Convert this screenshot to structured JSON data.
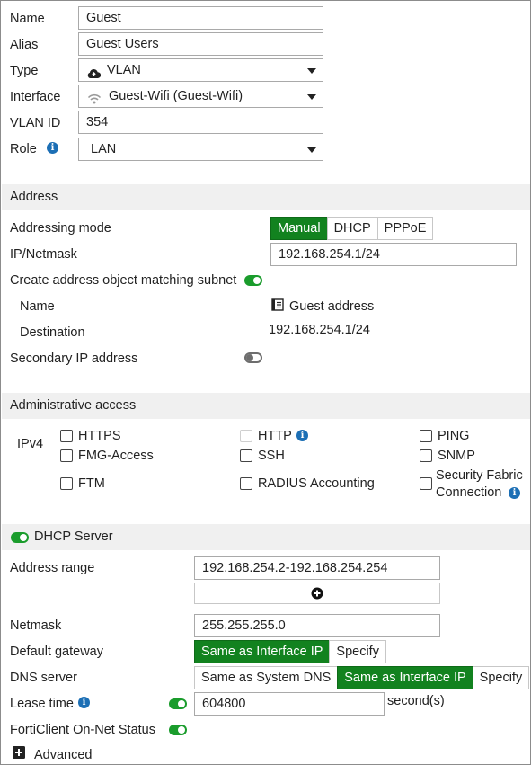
{
  "interface": {
    "name_label": "Name",
    "name_value": "Guest",
    "alias_label": "Alias",
    "alias_value": "Guest Users",
    "type_label": "Type",
    "type_value": "VLAN",
    "interface_label": "Interface",
    "interface_value": "Guest-Wifi (Guest-Wifi)",
    "vlan_label": "VLAN ID",
    "vlan_value": "354",
    "role_label": "Role",
    "role_value": "LAN"
  },
  "address": {
    "section_title": "Address",
    "mode_label": "Addressing mode",
    "mode_options": [
      "Manual",
      "DHCP",
      "PPPoE"
    ],
    "mode_selected": "Manual",
    "ip_label": "IP/Netmask",
    "ip_value": "192.168.254.1/24",
    "create_obj_label": "Create address object matching subnet",
    "create_obj_enabled": true,
    "obj_name_label": "Name",
    "obj_name_value": "Guest address",
    "dest_label": "Destination",
    "dest_value": "192.168.254.1/24",
    "secondary_label": "Secondary IP address",
    "secondary_enabled": false
  },
  "admin": {
    "section_title": "Administrative access",
    "ipv4_label": "IPv4",
    "options": {
      "https": "HTTPS",
      "http": "HTTP",
      "ping": "PING",
      "fmg": "FMG-Access",
      "ssh": "SSH",
      "snmp": "SNMP",
      "ftm": "FTM",
      "radius": "RADIUS Accounting",
      "sf1": "Security Fabric",
      "sf2": "Connection"
    }
  },
  "dhcp": {
    "section_title": "DHCP Server",
    "enabled": true,
    "range_label": "Address range",
    "range_value": "192.168.254.2-192.168.254.254",
    "netmask_label": "Netmask",
    "netmask_value": "255.255.255.0",
    "gateway_label": "Default gateway",
    "gateway_options": [
      "Same as Interface IP",
      "Specify"
    ],
    "gateway_selected": "Same as Interface IP",
    "dns_label": "DNS server",
    "dns_options": [
      "Same as System DNS",
      "Same as Interface IP",
      "Specify"
    ],
    "dns_selected": "Same as Interface IP",
    "lease_label": "Lease time",
    "lease_value": "604800",
    "lease_unit": "second(s)",
    "forticlient_label": "FortiClient On-Net Status",
    "advanced_label": "Advanced"
  },
  "colors": {
    "accent_green": "#12821f",
    "info_blue": "#1c6fb5",
    "section_bg": "#f0f0f0"
  }
}
